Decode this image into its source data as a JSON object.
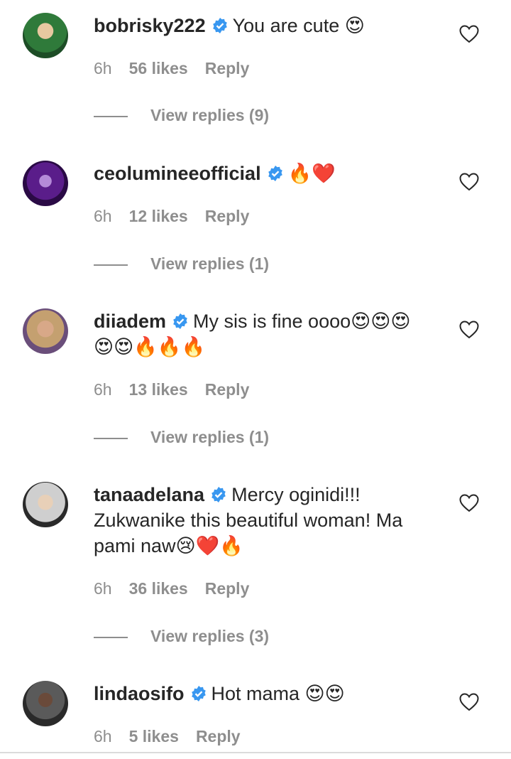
{
  "colors": {
    "text": "#262626",
    "muted": "#8e8e8e",
    "verified": "#3897f0",
    "background": "#ffffff"
  },
  "comments": [
    {
      "username": "bobrisky222",
      "text": "You are cute 😍",
      "text_line2": "",
      "time": "6h",
      "likes": "56 likes",
      "reply": "Reply",
      "view_replies": "View replies (9)"
    },
    {
      "username": "ceolumineeofficial",
      "text": "🔥❤️",
      "text_line2": "",
      "time": "6h",
      "likes": "12 likes",
      "reply": "Reply",
      "view_replies": "View replies (1)"
    },
    {
      "username": "diiadem",
      "text": "My sis is fine oooo😍😍😍",
      "text_line2": "😍😍🔥🔥🔥",
      "time": "6h",
      "likes": "13 likes",
      "reply": "Reply",
      "view_replies": "View replies (1)"
    },
    {
      "username": "tanaadelana",
      "text": "Mercy oginidi!!!",
      "text_line2": "Zukwanike this beautiful woman! Ma",
      "text_line3": "pami naw😢❤️🔥",
      "time": "6h",
      "likes": "36 likes",
      "reply": "Reply",
      "view_replies": "View replies (3)"
    },
    {
      "username": "lindaosifo",
      "text": "Hot mama 😍😍",
      "text_line2": "",
      "time": "6h",
      "likes": "5 likes",
      "reply": "Reply",
      "view_replies": ""
    }
  ]
}
